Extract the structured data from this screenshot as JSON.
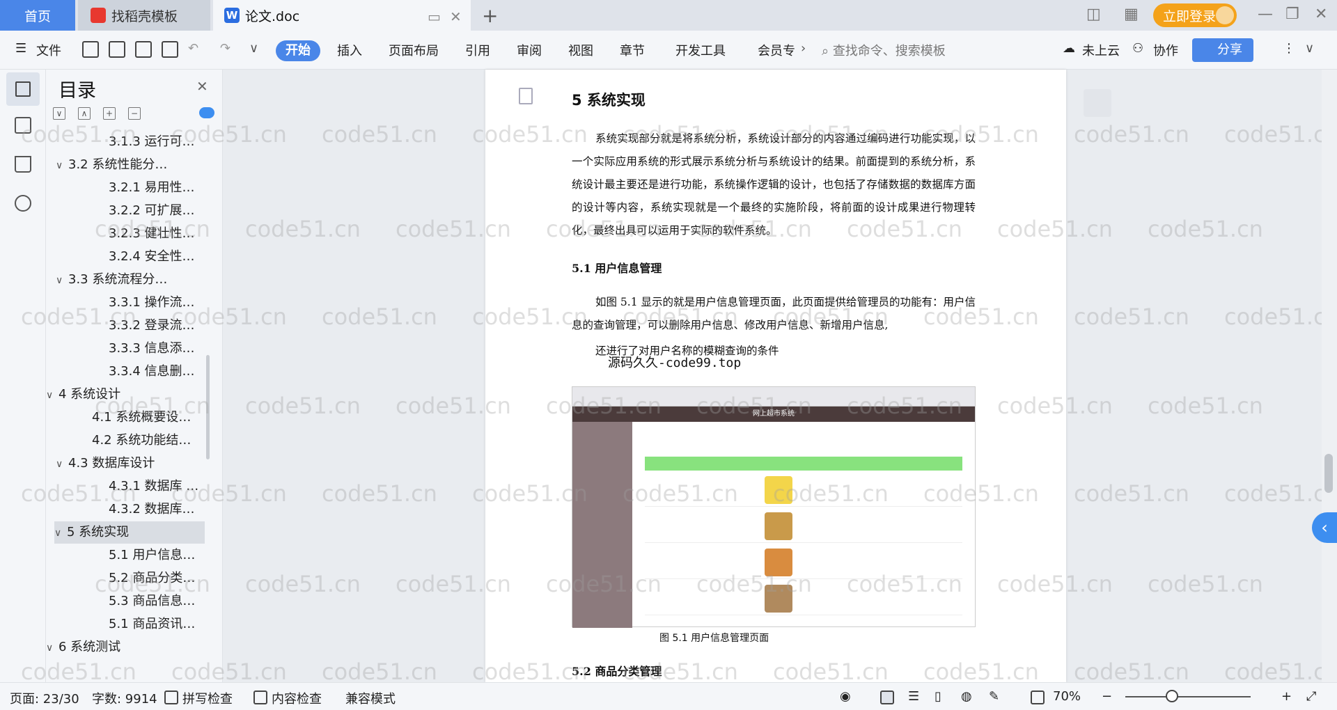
{
  "tabs": {
    "home": "首页",
    "template": "找稻壳模板",
    "doc": "论文.doc",
    "new_tab": "+",
    "login": "立即登录"
  },
  "toolbar": {
    "file": "文件",
    "menus": [
      "开始",
      "插入",
      "页面布局",
      "引用",
      "审阅",
      "视图",
      "章节",
      "开发工具",
      "会员专"
    ],
    "search_placeholder": "查找命令、搜索模板",
    "cloud": "未上云",
    "collab": "协作",
    "share": "分享"
  },
  "toc": {
    "title": "目录",
    "items": [
      {
        "label": "3.1.3  运行可…",
        "level": 3
      },
      {
        "label": "3.2  系统性能分…",
        "level": 2,
        "caret": "∨"
      },
      {
        "label": "3.2.1  易用性…",
        "level": 3
      },
      {
        "label": "3.2.2  可扩展…",
        "level": 3
      },
      {
        "label": "3.2.3  健壮性…",
        "level": 3
      },
      {
        "label": "3.2.4  安全性…",
        "level": 3
      },
      {
        "label": "3.3  系统流程分…",
        "level": 2,
        "caret": "∨"
      },
      {
        "label": "3.3.1  操作流…",
        "level": 3
      },
      {
        "label": "3.3.2  登录流…",
        "level": 3
      },
      {
        "label": "3.3.3  信息添…",
        "level": 3
      },
      {
        "label": "3.3.4  信息删…",
        "level": 3
      },
      {
        "label": "4  系统设计",
        "level": 1,
        "caret": "∨"
      },
      {
        "label": "4.1  系统概要设…",
        "level": 2
      },
      {
        "label": "4.2  系统功能结…",
        "level": 2
      },
      {
        "label": "4.3  数据库设计",
        "level": 2,
        "caret": "∨"
      },
      {
        "label": "4.3.1  数据库 …",
        "level": 3
      },
      {
        "label": "4.3.2  数据库…",
        "level": 3
      },
      {
        "label": "5  系统实现",
        "level": 1,
        "caret": "∨",
        "active": true
      },
      {
        "label": "5.1 用户信息…",
        "level": 3
      },
      {
        "label": "5.2  商品分类…",
        "level": 3
      },
      {
        "label": "5.3 商品信息…",
        "level": 3
      },
      {
        "label": "5.1 商品资讯…",
        "level": 3
      },
      {
        "label": "6  系统测试",
        "level": 1,
        "caret": "∨"
      }
    ]
  },
  "document": {
    "section_title": "5  系统实现",
    "para1": "系统实现部分就是将系统分析，系统设计部分的内容通过编码进行功能实现，以一个实际应用系统的形式展示系统分析与系统设计的结果。前面提到的系统分析，系统设计最主要还是进行功能，系统操作逻辑的设计，也包括了存储数据的数据库方面的设计等内容，系统实现就是一个最终的实施阶段，将前面的设计成果进行物理转化，最终出具可以运用于实际的软件系统。",
    "sub1": "5.1 用户信息管理",
    "para2": "如图 5.1 显示的就是用户信息管理页面，此页面提供给管理员的功能有：用户信息的查询管理，可以删除用户信息、修改用户信息、新增用户信息,",
    "para2b": "还进行了对用户名称的模糊查询的条件",
    "code_watermark": "源码久久-code99.top",
    "figure_header": "网上超市系统",
    "figure_caption": "图 5.1  用户信息管理页面",
    "sub2": "5.2  商品分类管理"
  },
  "watermark": "code51.cn",
  "status": {
    "page": "页面: 23/30",
    "words": "字数: 9914",
    "spell": "拼写检查",
    "content": "内容检查",
    "compat": "兼容模式",
    "zoom": "70%"
  },
  "colors": {
    "accent": "#4a86e8",
    "login": "#f4a21a",
    "figure_green": "#88e27e"
  }
}
